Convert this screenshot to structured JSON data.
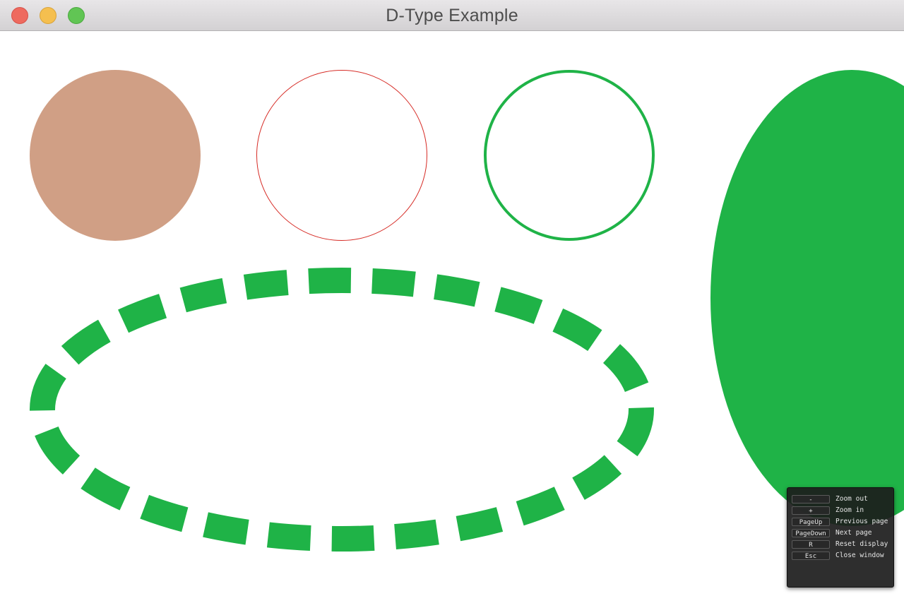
{
  "window": {
    "title": "D-Type Example"
  },
  "canvas": {
    "colors": {
      "filled_circle": "#d09f85",
      "thin_circle_stroke": "#d62b25",
      "green": "#1fb347"
    }
  },
  "help_panel": {
    "rows": [
      {
        "key": "-",
        "label": "Zoom out"
      },
      {
        "key": "+",
        "label": "Zoom in"
      },
      {
        "key": "PageUp",
        "label": "Previous page"
      },
      {
        "key": "PageDown",
        "label": "Next page"
      },
      {
        "key": "R",
        "label": "Reset display"
      },
      {
        "key": "Esc",
        "label": "Close window"
      }
    ]
  }
}
